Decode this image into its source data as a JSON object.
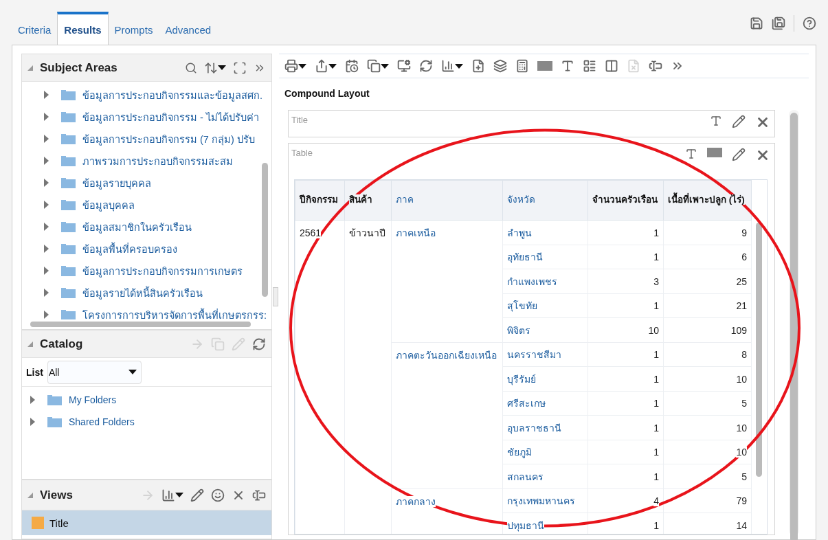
{
  "tabs": [
    {
      "label": "Criteria",
      "selected": false
    },
    {
      "label": "Results",
      "selected": true
    },
    {
      "label": "Prompts",
      "selected": false
    },
    {
      "label": "Advanced",
      "selected": false
    }
  ],
  "header_tools": [
    {
      "kind": "save",
      "disabled": false
    },
    {
      "kind": "saveas",
      "disabled": false
    },
    {
      "kind": "help",
      "disabled": false
    }
  ],
  "subject_areas": {
    "title": "Subject Areas",
    "items": [
      {
        "label": "ข้อมูลการประกอบกิจกรรมและข้อมูลสศก."
      },
      {
        "label": "ข้อมูลการประกอบกิจกรรม - ไม่ได้ปรับค่า"
      },
      {
        "label": "ข้อมูลการประกอบกิจกรรม (7 กลุ่ม) ปรับ"
      },
      {
        "label": "ภาพรวมการประกอบกิจกรรมสะสม"
      },
      {
        "label": "ข้อมูลรายบุคคล"
      },
      {
        "label": "ข้อมูลบุคคล"
      },
      {
        "label": "ข้อมูลสมาชิกในครัวเรือน"
      },
      {
        "label": "ข้อมูลพื้นที่ครอบครอง"
      },
      {
        "label": "ข้อมูลการประกอบกิจกรรมการเกษตร"
      },
      {
        "label": "ข้อมูลรายได้หนี้สินครัวเรือน"
      },
      {
        "label": "โครงการการบริหารจัดการพื้นที่เกษตรกรร:"
      }
    ]
  },
  "catalog": {
    "title": "Catalog",
    "tools": [
      {
        "kind": "send",
        "disabled": true
      },
      {
        "kind": "copy",
        "disabled": true
      },
      {
        "kind": "edit",
        "disabled": true
      },
      {
        "kind": "refresh",
        "disabled": false
      }
    ],
    "list_label": "List",
    "list_value": "All",
    "folders": [
      {
        "label": "My Folders"
      },
      {
        "label": "Shared Folders"
      }
    ]
  },
  "views": {
    "title": "Views",
    "tools": [
      {
        "kind": "send",
        "disabled": true
      },
      {
        "kind": "chart",
        "disabled": false
      },
      {
        "kind": "edit",
        "disabled": false
      },
      {
        "kind": "merge",
        "disabled": false
      },
      {
        "kind": "delete",
        "disabled": false
      },
      {
        "kind": "rename",
        "disabled": false
      }
    ],
    "items": [
      {
        "label": "Title",
        "selected": true
      }
    ]
  },
  "toolbar": [
    {
      "kind": "print",
      "disabled": false
    },
    {
      "kind": "export",
      "disabled": false
    },
    {
      "kind": "schedule",
      "disabled": false
    },
    {
      "kind": "copy",
      "disabled": false
    },
    {
      "kind": "settings",
      "disabled": false
    },
    {
      "kind": "refresh",
      "disabled": false
    },
    {
      "kind": "chart",
      "disabled": false
    },
    {
      "kind": "addfile",
      "disabled": false
    },
    {
      "kind": "layers",
      "disabled": false
    },
    {
      "kind": "calc",
      "disabled": false
    },
    {
      "kind": "xyz",
      "disabled": false
    },
    {
      "kind": "text",
      "disabled": false
    },
    {
      "kind": "addview",
      "disabled": false
    },
    {
      "kind": "grid",
      "disabled": false
    },
    {
      "kind": "remove",
      "disabled": true
    },
    {
      "kind": "rename",
      "disabled": false
    },
    {
      "kind": "more",
      "disabled": false
    }
  ],
  "layout": {
    "title": "Compound Layout",
    "title_view": {
      "label": "Title"
    },
    "table_view": {
      "label": "Table",
      "columns": [
        {
          "label": "ปีกิจกรรม",
          "link": false
        },
        {
          "label": "สินค้า",
          "link": false
        },
        {
          "label": "ภาค",
          "link": true
        },
        {
          "label": "จังหวัด",
          "link": true
        },
        {
          "label": "จำนวนครัวเรือน",
          "link": false
        },
        {
          "label": "เนื้อที่เพาะปลูก (ไร่)",
          "link": false
        }
      ],
      "groups": [
        {
          "year": "2561",
          "product": "ข้าวนาปี",
          "regions": [
            {
              "name": "ภาคเหนือ",
              "provinces": [
                {
                  "name": "ลำพูน",
                  "households": "1",
                  "area": "9"
                },
                {
                  "name": "อุทัยธานี",
                  "households": "1",
                  "area": "6"
                },
                {
                  "name": "กำแพงเพชร",
                  "households": "3",
                  "area": "25"
                },
                {
                  "name": "สุโขทัย",
                  "households": "1",
                  "area": "21"
                },
                {
                  "name": "พิจิตร",
                  "households": "10",
                  "area": "109"
                }
              ]
            },
            {
              "name": "ภาคตะวันออกเฉียงเหนือ",
              "provinces": [
                {
                  "name": "นครราชสีมา",
                  "households": "1",
                  "area": "8"
                },
                {
                  "name": "บุรีรัมย์",
                  "households": "1",
                  "area": "10"
                },
                {
                  "name": "ศรีสะเกษ",
                  "households": "1",
                  "area": "5"
                },
                {
                  "name": "อุบลราชธานี",
                  "households": "1",
                  "area": "10"
                },
                {
                  "name": "ชัยภูมิ",
                  "households": "1",
                  "area": "10"
                },
                {
                  "name": "สกลนคร",
                  "households": "1",
                  "area": "5"
                }
              ]
            },
            {
              "name": "ภาคกลาง",
              "provinces": [
                {
                  "name": "กรุงเทพมหานคร",
                  "households": "4",
                  "area": "79"
                },
                {
                  "name": "ปทุมธานี",
                  "households": "1",
                  "area": "14"
                }
              ]
            }
          ]
        }
      ]
    }
  }
}
